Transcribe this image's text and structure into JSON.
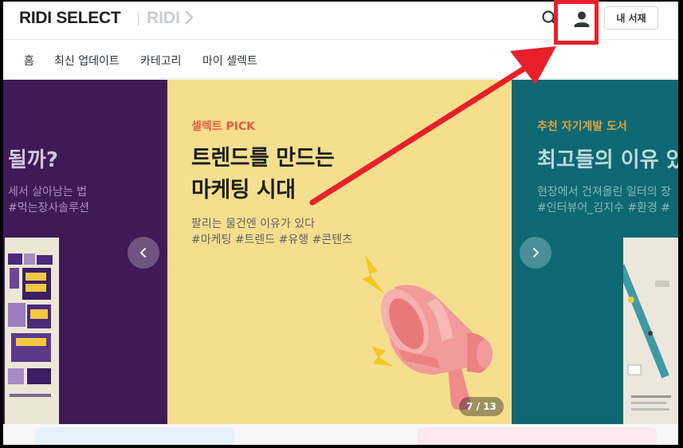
{
  "header": {
    "logo": "RIDI SELECT",
    "ridi_link": "RIDI",
    "my_books_label": "내 서재",
    "icons": {
      "search": "search-icon",
      "user": "user-icon",
      "chevron": "chevron-right-icon"
    }
  },
  "nav": {
    "items": [
      {
        "label": "홈"
      },
      {
        "label": "최신 업데이트"
      },
      {
        "label": "카테고리"
      },
      {
        "label": "마이 셀렉트"
      }
    ]
  },
  "carousel": {
    "left": {
      "title": "될까?",
      "sub1": "세서 살아남는 법",
      "sub2": "#먹는장사솔루션"
    },
    "main": {
      "eyebrow": "셀렉트 PICK",
      "title_line1": "트렌드를 만드는",
      "title_line2": "마케팅 시대",
      "sub1": "팔리는 물건엔 이유가 있다",
      "sub2": "#마케팅 #트렌드 #유행 #콘텐츠",
      "counter": "7 / 13"
    },
    "right": {
      "eyebrow": "추천 자기계발 도서",
      "title": "최고들의 이유 있",
      "sub1": "현장에서 건져올린 일터의 장",
      "sub2": "#인터뷰어_김지수 #환경 #"
    }
  },
  "colors": {
    "left_bg": "#3f1a57",
    "main_bg": "#f5df8f",
    "right_bg": "#0e6874",
    "eyebrow": "#e85b3f",
    "annotation": "#e8202a"
  }
}
